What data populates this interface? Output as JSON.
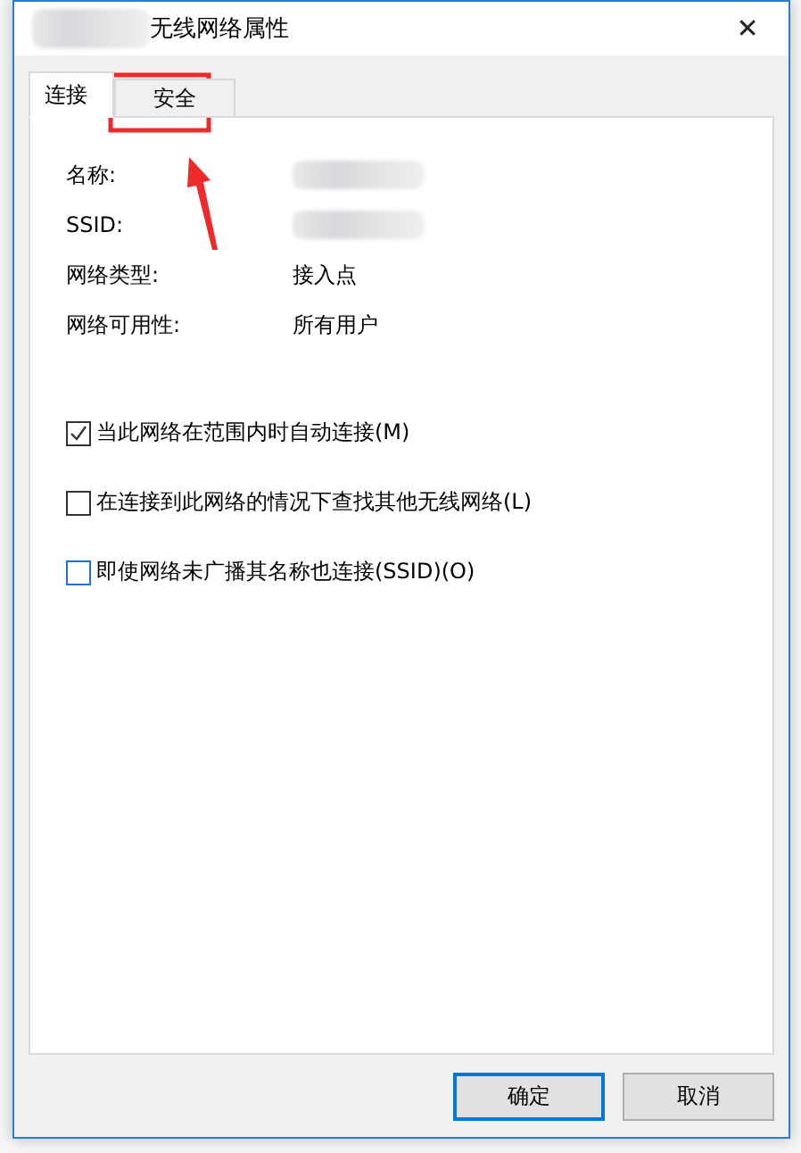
{
  "window": {
    "title": "无线网络属性",
    "close": "✕"
  },
  "tabs": [
    {
      "label": "连接",
      "selected": true
    },
    {
      "label": "安全",
      "selected": false
    }
  ],
  "properties": [
    {
      "label": "名称:",
      "value_redacted": true
    },
    {
      "label": "SSID:",
      "value_redacted": true
    },
    {
      "label": "网络类型:",
      "value": "接入点"
    },
    {
      "label": "网络可用性:",
      "value": "所有用户"
    }
  ],
  "options": [
    {
      "label": "当此网络在范围内时自动连接(M)",
      "checked": true,
      "focused": false
    },
    {
      "label": "在连接到此网络的情况下查找其他无线网络(L)",
      "checked": false,
      "focused": false
    },
    {
      "label": "即使网络未广播其名称也连接(SSID)(O)",
      "checked": false,
      "focused": true
    }
  ],
  "buttons": [
    {
      "label": "确定",
      "default": true
    },
    {
      "label": "取消",
      "default": false
    }
  ]
}
